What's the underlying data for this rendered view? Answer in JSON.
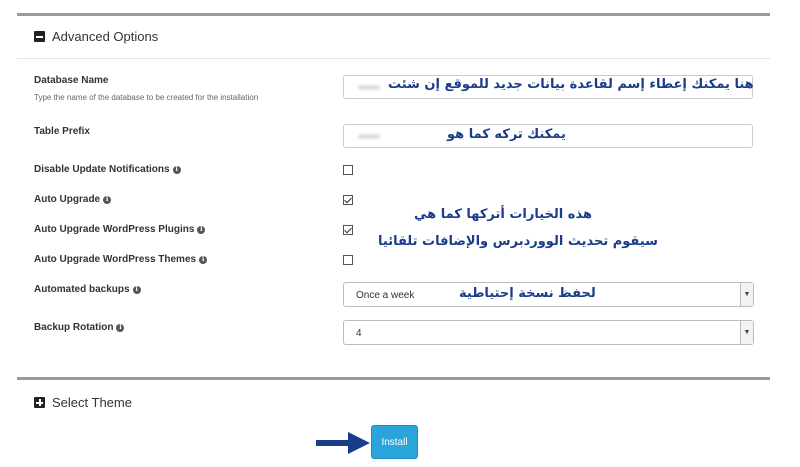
{
  "advanced": {
    "title": "Advanced Options",
    "database_name": {
      "label": "Database Name",
      "help": "Type the name of the database to be created for the installation",
      "annotation": "هنا يمكنك إعطاء إسم لقاعدة بيانات جديد للموقع إن شئت"
    },
    "table_prefix": {
      "label": "Table Prefix",
      "annotation": "يمكنك تركه كما هو"
    },
    "disable_update_notifications": {
      "label": "Disable Update Notifications",
      "checked": false
    },
    "auto_upgrade": {
      "label": "Auto Upgrade",
      "checked": true
    },
    "auto_upgrade_plugins": {
      "label": "Auto Upgrade WordPress Plugins",
      "checked": true
    },
    "auto_upgrade_themes": {
      "label": "Auto Upgrade WordPress Themes",
      "checked": false
    },
    "checkbox_annotation_line1": "هذه الخيارات أتركها كما هي",
    "checkbox_annotation_line2": "سيقوم تحديث الووردبرس والإضافات تلقائيا",
    "automated_backups": {
      "label": "Automated backups",
      "value": "Once a week",
      "annotation": "لحفظ نسخة إحتياطية"
    },
    "backup_rotation": {
      "label": "Backup Rotation",
      "value": "4"
    }
  },
  "select_theme": {
    "title": "Select Theme"
  },
  "install": {
    "label": "Install"
  },
  "icons": {
    "info": "i"
  }
}
